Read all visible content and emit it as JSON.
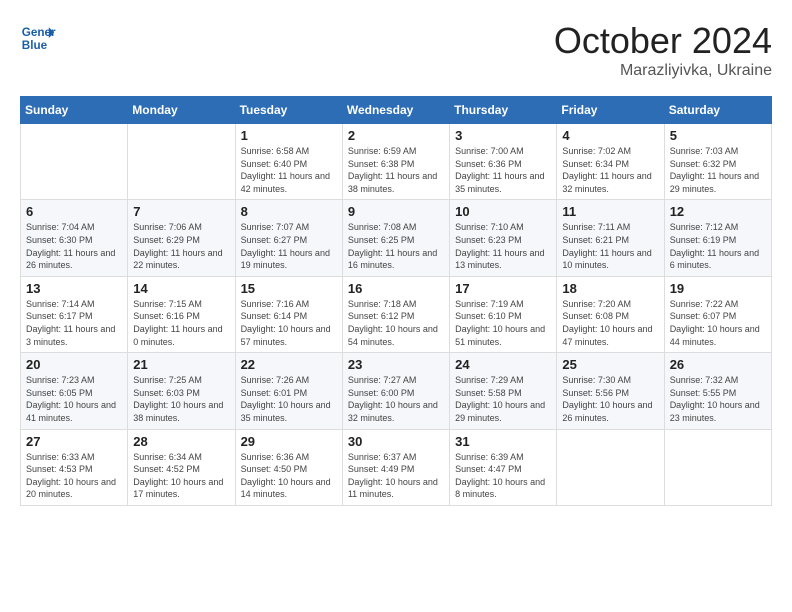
{
  "header": {
    "logo_line1": "General",
    "logo_line2": "Blue",
    "month": "October 2024",
    "location": "Marazliyivka, Ukraine"
  },
  "weekdays": [
    "Sunday",
    "Monday",
    "Tuesday",
    "Wednesday",
    "Thursday",
    "Friday",
    "Saturday"
  ],
  "weeks": [
    [
      {
        "day": "",
        "info": ""
      },
      {
        "day": "",
        "info": ""
      },
      {
        "day": "1",
        "info": "Sunrise: 6:58 AM\nSunset: 6:40 PM\nDaylight: 11 hours and 42 minutes."
      },
      {
        "day": "2",
        "info": "Sunrise: 6:59 AM\nSunset: 6:38 PM\nDaylight: 11 hours and 38 minutes."
      },
      {
        "day": "3",
        "info": "Sunrise: 7:00 AM\nSunset: 6:36 PM\nDaylight: 11 hours and 35 minutes."
      },
      {
        "day": "4",
        "info": "Sunrise: 7:02 AM\nSunset: 6:34 PM\nDaylight: 11 hours and 32 minutes."
      },
      {
        "day": "5",
        "info": "Sunrise: 7:03 AM\nSunset: 6:32 PM\nDaylight: 11 hours and 29 minutes."
      }
    ],
    [
      {
        "day": "6",
        "info": "Sunrise: 7:04 AM\nSunset: 6:30 PM\nDaylight: 11 hours and 26 minutes."
      },
      {
        "day": "7",
        "info": "Sunrise: 7:06 AM\nSunset: 6:29 PM\nDaylight: 11 hours and 22 minutes."
      },
      {
        "day": "8",
        "info": "Sunrise: 7:07 AM\nSunset: 6:27 PM\nDaylight: 11 hours and 19 minutes."
      },
      {
        "day": "9",
        "info": "Sunrise: 7:08 AM\nSunset: 6:25 PM\nDaylight: 11 hours and 16 minutes."
      },
      {
        "day": "10",
        "info": "Sunrise: 7:10 AM\nSunset: 6:23 PM\nDaylight: 11 hours and 13 minutes."
      },
      {
        "day": "11",
        "info": "Sunrise: 7:11 AM\nSunset: 6:21 PM\nDaylight: 11 hours and 10 minutes."
      },
      {
        "day": "12",
        "info": "Sunrise: 7:12 AM\nSunset: 6:19 PM\nDaylight: 11 hours and 6 minutes."
      }
    ],
    [
      {
        "day": "13",
        "info": "Sunrise: 7:14 AM\nSunset: 6:17 PM\nDaylight: 11 hours and 3 minutes."
      },
      {
        "day": "14",
        "info": "Sunrise: 7:15 AM\nSunset: 6:16 PM\nDaylight: 11 hours and 0 minutes."
      },
      {
        "day": "15",
        "info": "Sunrise: 7:16 AM\nSunset: 6:14 PM\nDaylight: 10 hours and 57 minutes."
      },
      {
        "day": "16",
        "info": "Sunrise: 7:18 AM\nSunset: 6:12 PM\nDaylight: 10 hours and 54 minutes."
      },
      {
        "day": "17",
        "info": "Sunrise: 7:19 AM\nSunset: 6:10 PM\nDaylight: 10 hours and 51 minutes."
      },
      {
        "day": "18",
        "info": "Sunrise: 7:20 AM\nSunset: 6:08 PM\nDaylight: 10 hours and 47 minutes."
      },
      {
        "day": "19",
        "info": "Sunrise: 7:22 AM\nSunset: 6:07 PM\nDaylight: 10 hours and 44 minutes."
      }
    ],
    [
      {
        "day": "20",
        "info": "Sunrise: 7:23 AM\nSunset: 6:05 PM\nDaylight: 10 hours and 41 minutes."
      },
      {
        "day": "21",
        "info": "Sunrise: 7:25 AM\nSunset: 6:03 PM\nDaylight: 10 hours and 38 minutes."
      },
      {
        "day": "22",
        "info": "Sunrise: 7:26 AM\nSunset: 6:01 PM\nDaylight: 10 hours and 35 minutes."
      },
      {
        "day": "23",
        "info": "Sunrise: 7:27 AM\nSunset: 6:00 PM\nDaylight: 10 hours and 32 minutes."
      },
      {
        "day": "24",
        "info": "Sunrise: 7:29 AM\nSunset: 5:58 PM\nDaylight: 10 hours and 29 minutes."
      },
      {
        "day": "25",
        "info": "Sunrise: 7:30 AM\nSunset: 5:56 PM\nDaylight: 10 hours and 26 minutes."
      },
      {
        "day": "26",
        "info": "Sunrise: 7:32 AM\nSunset: 5:55 PM\nDaylight: 10 hours and 23 minutes."
      }
    ],
    [
      {
        "day": "27",
        "info": "Sunrise: 6:33 AM\nSunset: 4:53 PM\nDaylight: 10 hours and 20 minutes."
      },
      {
        "day": "28",
        "info": "Sunrise: 6:34 AM\nSunset: 4:52 PM\nDaylight: 10 hours and 17 minutes."
      },
      {
        "day": "29",
        "info": "Sunrise: 6:36 AM\nSunset: 4:50 PM\nDaylight: 10 hours and 14 minutes."
      },
      {
        "day": "30",
        "info": "Sunrise: 6:37 AM\nSunset: 4:49 PM\nDaylight: 10 hours and 11 minutes."
      },
      {
        "day": "31",
        "info": "Sunrise: 6:39 AM\nSunset: 4:47 PM\nDaylight: 10 hours and 8 minutes."
      },
      {
        "day": "",
        "info": ""
      },
      {
        "day": "",
        "info": ""
      }
    ]
  ]
}
